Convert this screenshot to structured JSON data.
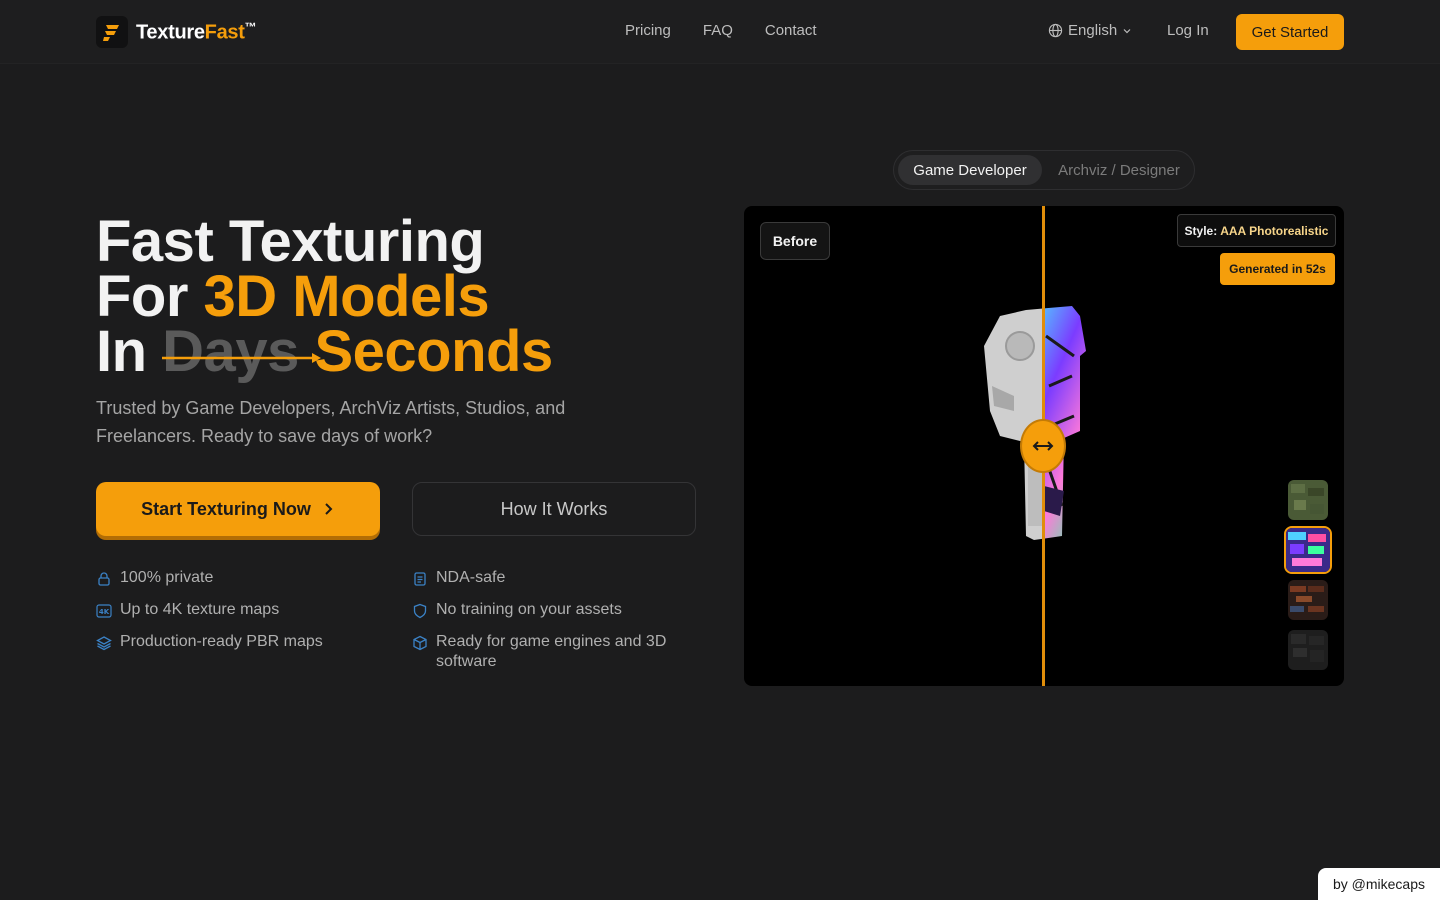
{
  "header": {
    "logo_word1": "Texture",
    "logo_word2": "Fast",
    "logo_tm": "™",
    "nav": [
      "Pricing",
      "FAQ",
      "Contact"
    ],
    "language": "English",
    "login": "Log In",
    "cta": "Get Started"
  },
  "hero": {
    "line1": "Fast Texturing",
    "line2_prefix": "For ",
    "line2_highlight": "3D Models",
    "line3_prefix": "In ",
    "line3_struck": "Days",
    "line3_highlight": "Seconds",
    "subtitle": "Trusted by Game Developers, ArchViz Artists, Studios, and Freelancers. Ready to save days of work?",
    "primary_button": "Start Texturing Now",
    "secondary_button": "How It Works"
  },
  "features": [
    {
      "icon": "lock-icon",
      "label": "100% private"
    },
    {
      "icon": "document-icon",
      "label": "NDA-safe"
    },
    {
      "icon": "4k-icon",
      "label": "Up to 4K texture maps"
    },
    {
      "icon": "shield-icon",
      "label": "No training on your assets"
    },
    {
      "icon": "layers-icon",
      "label": "Production-ready PBR maps"
    },
    {
      "icon": "cube-icon",
      "label": "Ready for game engines and 3D software"
    }
  ],
  "showcase": {
    "tabs": [
      "Game Developer",
      "Archviz / Designer"
    ],
    "active_tab": "Game Developer",
    "before_label": "Before",
    "style_label": "Style:",
    "style_value": "AAA Photorealistic",
    "generated_label": "Generated in 52s",
    "thumbnails": [
      "green-camo-texture",
      "neon-graffiti-texture",
      "rusty-brick-texture",
      "dark-stone-texture"
    ],
    "selected_thumbnail": 1
  },
  "credit": "by @mikecaps",
  "colors": {
    "accent": "#f59e0b",
    "background": "#1c1c1d",
    "icon_accent": "#3b82c6"
  }
}
